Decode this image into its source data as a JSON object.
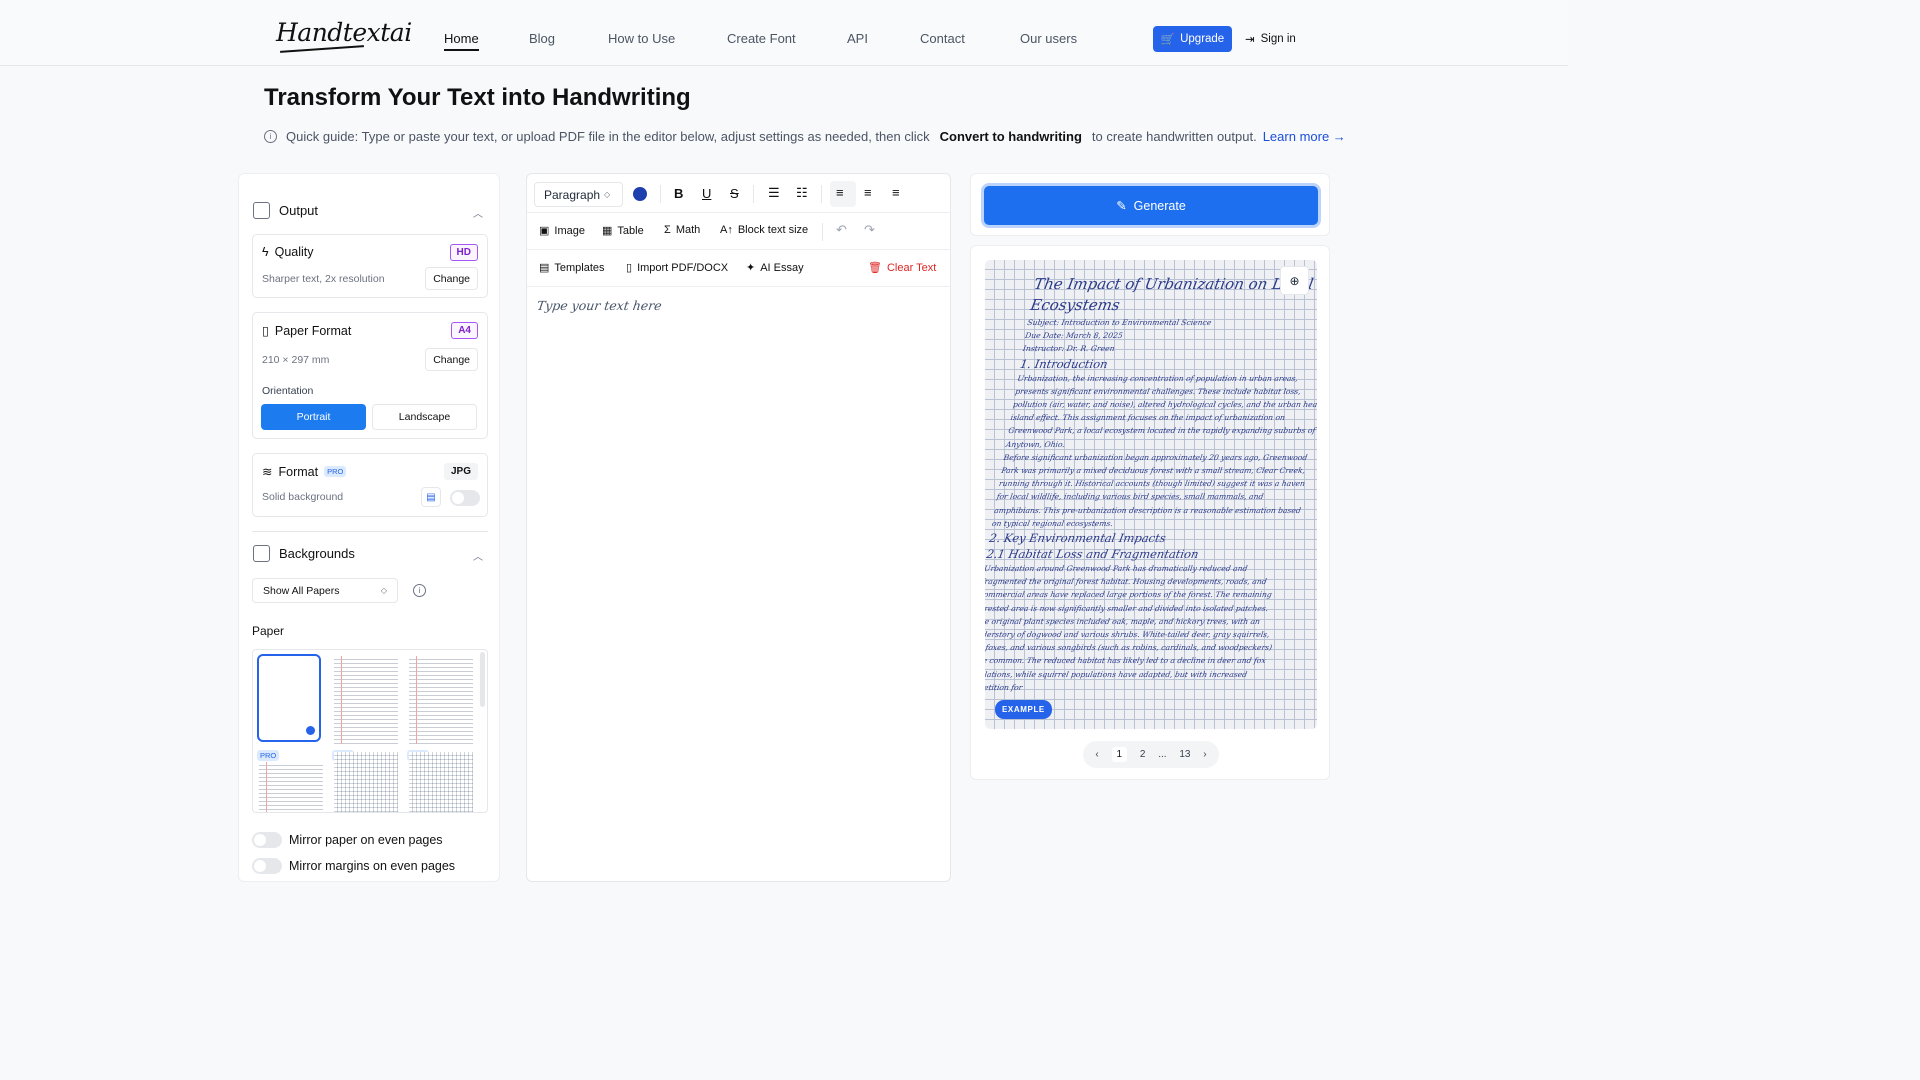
{
  "header": {
    "logo": "Handtextai",
    "nav": [
      {
        "label": "Home",
        "active": true
      },
      {
        "label": "Blog"
      },
      {
        "label": "How to Use"
      },
      {
        "label": "Create Font"
      },
      {
        "label": "API"
      },
      {
        "label": "Contact"
      },
      {
        "label": "Our users"
      }
    ],
    "upgrade_label": "Upgrade",
    "signin_label": "Sign in"
  },
  "page": {
    "title": "Transform Your Text into Handwriting",
    "guide_prefix": "Quick guide: Type or paste your text, or upload PDF file in the editor below, adjust settings as needed, then click",
    "guide_bold": "Convert to handwriting",
    "guide_suffix": "to create handwritten output.",
    "learn_more": "Learn more →"
  },
  "left": {
    "output": {
      "title": "Output",
      "quality": {
        "title": "Quality",
        "badge": "HD",
        "sub": "Sharper text, 2x resolution",
        "button": "Change"
      },
      "paper_format": {
        "title": "Paper Format",
        "badge": "A4",
        "sub": "210 × 297 mm",
        "button": "Change",
        "orientation_label": "Orientation",
        "portrait": "Portrait",
        "landscape": "Landscape"
      },
      "format": {
        "title": "Format",
        "pro": "PRO",
        "badge": "JPG",
        "sub": "Solid background"
      }
    },
    "backgrounds": {
      "title": "Backgrounds",
      "filter": "Show All Papers",
      "paper_label": "Paper",
      "pro_tag": "PRO"
    },
    "toggles": {
      "mirror_paper": "Mirror paper on even pages",
      "mirror_margins": "Mirror margins on even pages"
    }
  },
  "editor": {
    "block_select": "Paragraph",
    "text_color": "#1e40af",
    "row2": {
      "image": "Image",
      "table": "Table",
      "math": "Math",
      "block_size": "Block text size"
    },
    "row3": {
      "templates": "Templates",
      "import": "Import PDF/DOCX",
      "essay": "AI Essay",
      "clear": "Clear Text"
    },
    "placeholder": "Type your text here"
  },
  "right": {
    "generate_label": "Generate",
    "example_badge": "EXAMPLE",
    "pager": {
      "current": "1",
      "next": "2",
      "ellipsis": "...",
      "last": "13"
    },
    "sample": {
      "title": "The Impact of Urbanization on Local Ecosystems",
      "meta": [
        "Subject: Introduction to Environmental Science",
        "Due Date: March 8, 2025",
        "Instructor: Dr. R. Green"
      ],
      "h1": "1. Introduction",
      "p1": "Urbanization, the increasing concentration of population in urban areas, presents significant environmental challenges. These include habitat loss, pollution (air, water, and noise), altered hydrological cycles, and the urban heat island effect. This assignment focuses on the impact of urbanization on Greenwood Park, a local ecosystem located in the rapidly expanding suburbs of Anytown, Ohio.",
      "p2": "Before significant urbanization began approximately 20 years ago, Greenwood Park was primarily a mixed deciduous forest with a small stream, Clear Creek, running through it. Historical accounts (though limited) suggest it was a haven for local wildlife, including various bird species, small mammals, and amphibians. This pre-urbanization description is a reasonable estimation based on typical regional ecosystems.",
      "h2": "2. Key Environmental Impacts",
      "h3": "2.1 Habitat Loss and Fragmentation",
      "p3": "Urbanization around Greenwood Park has dramatically reduced and fragmented the original forest habitat. Housing developments, roads, and commercial areas have replaced large portions of the forest. The remaining forested area is now significantly smaller and divided into isolated patches.",
      "p4": "The original plant species included oak, maple, and hickory trees, with an understory of dogwood and various shrubs. White-tailed deer, gray squirrels, red foxes, and various songbirds (such as robins, cardinals, and woodpeckers) were common. The reduced habitat has likely led to a decline in deer and fox populations, while squirrel populations have adapted, but with increased competition for"
    }
  }
}
